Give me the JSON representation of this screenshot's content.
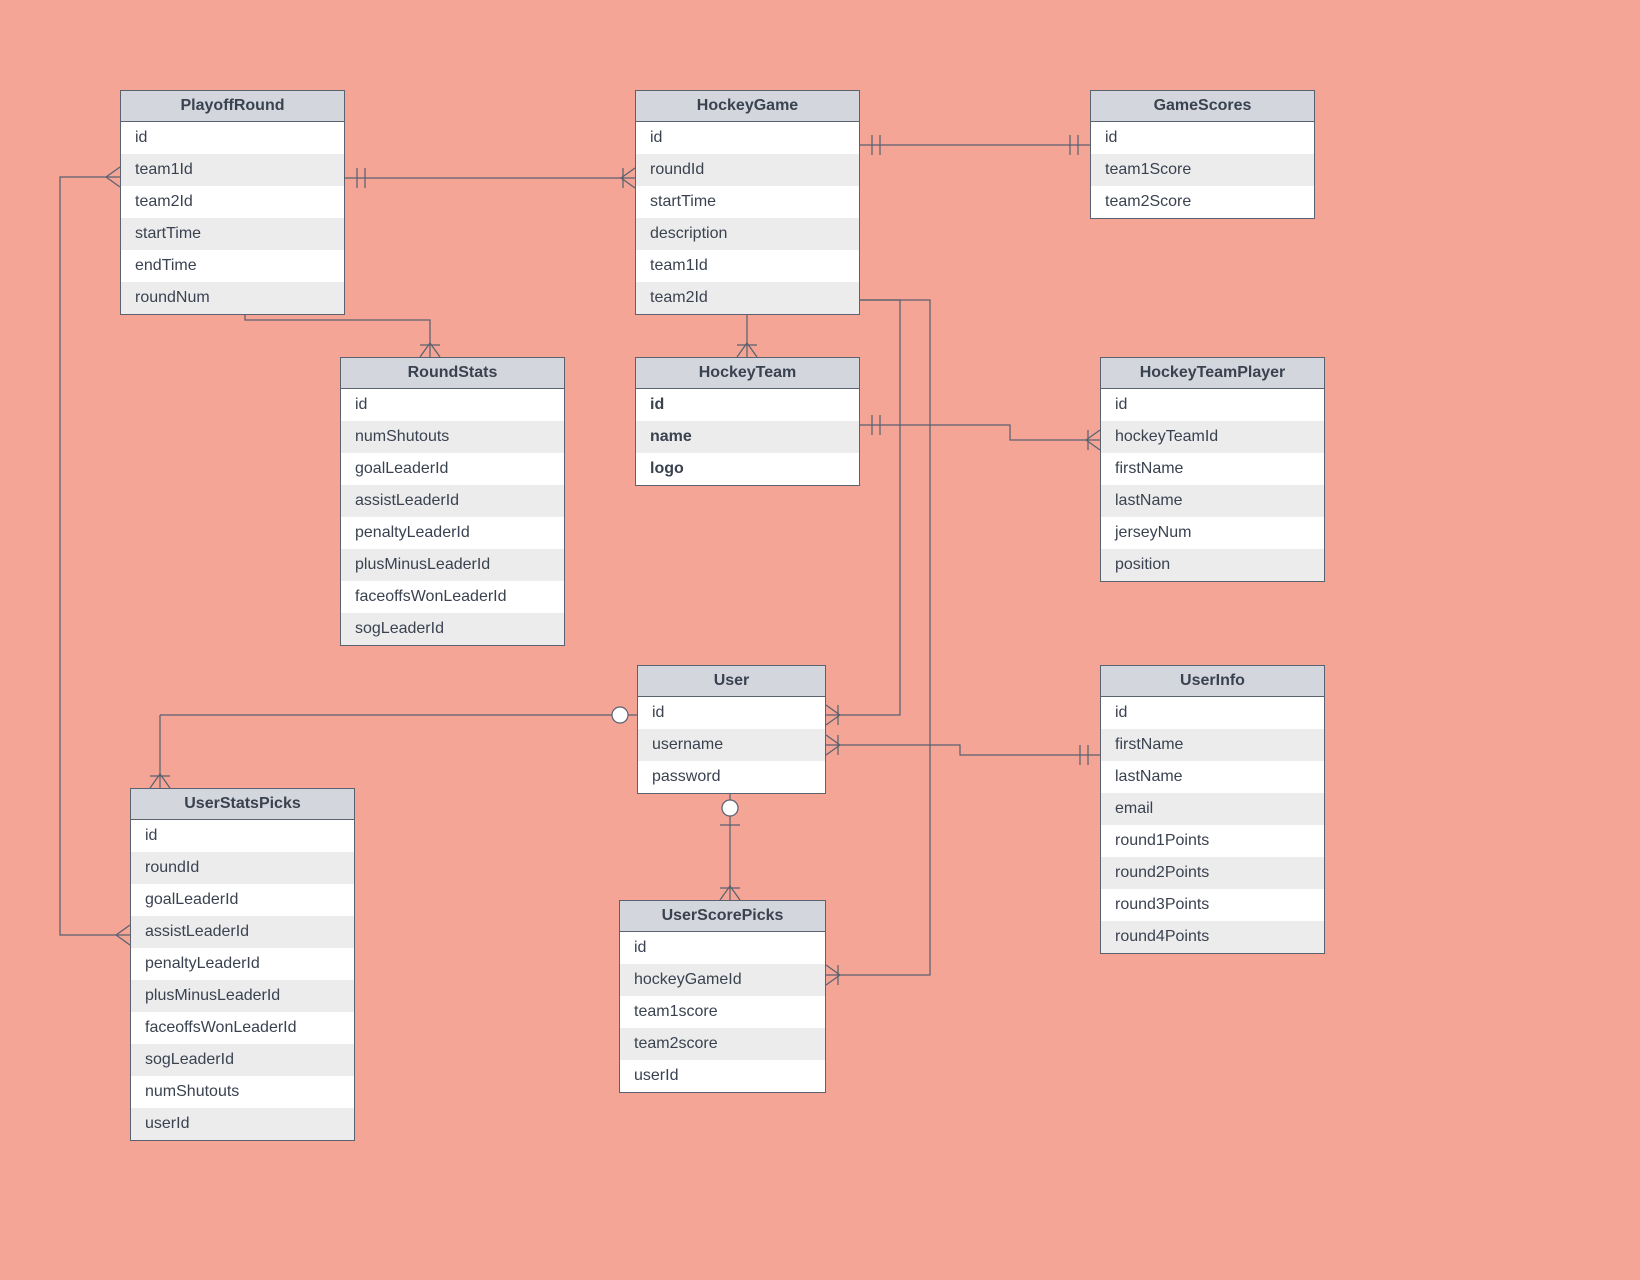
{
  "entities": {
    "playoffRound": {
      "title": "PlayoffRound",
      "fields": [
        "id",
        "team1Id",
        "team2Id",
        "startTime",
        "endTime",
        "roundNum"
      ]
    },
    "hockeyGame": {
      "title": "HockeyGame",
      "fields": [
        "id",
        "roundId",
        "startTime",
        "description",
        "team1Id",
        "team2Id"
      ]
    },
    "gameScores": {
      "title": "GameScores",
      "fields": [
        "id",
        "team1Score",
        "team2Score"
      ]
    },
    "roundStats": {
      "title": "RoundStats",
      "fields": [
        "id",
        "numShutouts",
        "goalLeaderId",
        "assistLeaderId",
        "penaltyLeaderId",
        "plusMinusLeaderId",
        "faceoffsWonLeaderId",
        "sogLeaderId"
      ]
    },
    "hockeyTeam": {
      "title": "HockeyTeam",
      "fields": [
        "id",
        "name",
        "logo"
      ]
    },
    "hockeyTeamPlayer": {
      "title": "HockeyTeamPlayer",
      "fields": [
        "id",
        "hockeyTeamId",
        "firstName",
        "lastName",
        "jerseyNum",
        "position"
      ]
    },
    "user": {
      "title": "User",
      "fields": [
        "id",
        "username",
        "password"
      ]
    },
    "userInfo": {
      "title": "UserInfo",
      "fields": [
        "id",
        "firstName",
        "lastName",
        "email",
        "round1Points",
        "round2Points",
        "round3Points",
        "round4Points"
      ]
    },
    "userStatsPicks": {
      "title": "UserStatsPicks",
      "fields": [
        "id",
        "roundId",
        "goalLeaderId",
        "assistLeaderId",
        "penaltyLeaderId",
        "plusMinusLeaderId",
        "faceoffsWonLeaderId",
        "sogLeaderId",
        "numShutouts",
        "userId"
      ]
    },
    "userScorePicks": {
      "title": "UserScorePicks",
      "fields": [
        "id",
        "hockeyGameId",
        "team1score",
        "team2score",
        "userId"
      ]
    }
  },
  "chart_data": {
    "type": "diagram",
    "diagram_kind": "entity-relationship",
    "entities": [
      {
        "name": "PlayoffRound",
        "attributes": [
          "id",
          "team1Id",
          "team2Id",
          "startTime",
          "endTime",
          "roundNum"
        ]
      },
      {
        "name": "HockeyGame",
        "attributes": [
          "id",
          "roundId",
          "startTime",
          "description",
          "team1Id",
          "team2Id"
        ]
      },
      {
        "name": "GameScores",
        "attributes": [
          "id",
          "team1Score",
          "team2Score"
        ]
      },
      {
        "name": "RoundStats",
        "attributes": [
          "id",
          "numShutouts",
          "goalLeaderId",
          "assistLeaderId",
          "penaltyLeaderId",
          "plusMinusLeaderId",
          "faceoffsWonLeaderId",
          "sogLeaderId"
        ]
      },
      {
        "name": "HockeyTeam",
        "attributes": [
          "id",
          "name",
          "logo"
        ],
        "bold": true
      },
      {
        "name": "HockeyTeamPlayer",
        "attributes": [
          "id",
          "hockeyTeamId",
          "firstName",
          "lastName",
          "jerseyNum",
          "position"
        ]
      },
      {
        "name": "User",
        "attributes": [
          "id",
          "username",
          "password"
        ]
      },
      {
        "name": "UserInfo",
        "attributes": [
          "id",
          "firstName",
          "lastName",
          "email",
          "round1Points",
          "round2Points",
          "round3Points",
          "round4Points"
        ]
      },
      {
        "name": "UserStatsPicks",
        "attributes": [
          "id",
          "roundId",
          "goalLeaderId",
          "assistLeaderId",
          "penaltyLeaderId",
          "plusMinusLeaderId",
          "faceoffsWonLeaderId",
          "sogLeaderId",
          "numShutouts",
          "userId"
        ]
      },
      {
        "name": "UserScorePicks",
        "attributes": [
          "id",
          "hockeyGameId",
          "team1score",
          "team2score",
          "userId"
        ]
      }
    ],
    "relationships": [
      {
        "from": "PlayoffRound",
        "to": "HockeyGame",
        "from_cardinality": "one-mandatory",
        "to_cardinality": "many-mandatory"
      },
      {
        "from": "HockeyGame",
        "to": "GameScores",
        "from_cardinality": "one-mandatory",
        "to_cardinality": "one-mandatory"
      },
      {
        "from": "PlayoffRound",
        "to": "RoundStats",
        "from_cardinality": "many",
        "to_cardinality": "many-mandatory"
      },
      {
        "from": "HockeyGame",
        "to": "HockeyTeam",
        "from_cardinality": "many-mandatory",
        "to_cardinality": "many-mandatory"
      },
      {
        "from": "HockeyTeam",
        "to": "HockeyTeamPlayer",
        "from_cardinality": "one-mandatory",
        "to_cardinality": "many-mandatory"
      },
      {
        "from": "HockeyGame",
        "to": "UserScorePicks",
        "from_cardinality": "many-mandatory",
        "to_cardinality": "many-mandatory"
      },
      {
        "from": "User",
        "to": "UserStatsPicks",
        "from_cardinality": "one-optional",
        "to_cardinality": "many-mandatory"
      },
      {
        "from": "User",
        "to": "UserScorePicks",
        "from_cardinality": "one-optional",
        "to_cardinality": "many-mandatory"
      },
      {
        "from": "User",
        "to": "UserInfo",
        "from_cardinality": "many-mandatory",
        "to_cardinality": "one-mandatory"
      },
      {
        "from": "PlayoffRound",
        "to": "UserStatsPicks",
        "from_cardinality": "many-mandatory",
        "to_cardinality": "many-mandatory"
      },
      {
        "from": "HockeyGame",
        "to": "User",
        "from_cardinality": "many-mandatory",
        "to_cardinality": "many-mandatory"
      }
    ]
  }
}
